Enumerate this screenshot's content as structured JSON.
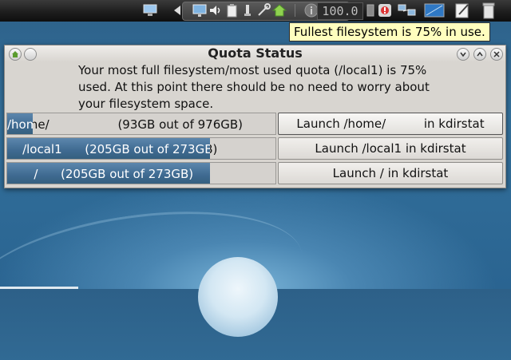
{
  "panel": {
    "network_label": "100.0",
    "icons": [
      "monitor-icon",
      "audio-icon",
      "display-icon",
      "volume-icon",
      "clipboard-icon",
      "power-icon",
      "tools-icon",
      "home-icon",
      "info-icon",
      "mail-alert-icon",
      "network-icon",
      "desktop-icon",
      "note-icon",
      "trash-icon"
    ]
  },
  "tooltip": {
    "text": "Fullest filesystem is 75% in use."
  },
  "window": {
    "title": "Quota Status",
    "message": "Your most full filesystem/most used quota (/local1) is 75% used.    At this point there should be no need to worry about your filesystem space.",
    "filesystems": [
      {
        "bar_label": "/home/                  (93GB out of 976GB)",
        "used_fraction": 0.095,
        "button_label": "Launch /home/          in kdirstat",
        "button_active": true
      },
      {
        "bar_label": "    /local1      (205GB out of 273GB)",
        "used_fraction": 0.75,
        "button_label": "Launch /local1 in kdirstat",
        "button_active": false
      },
      {
        "bar_label": "       /      (205GB out of 273GB)",
        "used_fraction": 0.75,
        "button_label": "Launch / in kdirstat",
        "button_active": false
      }
    ]
  },
  "colors": {
    "accent": "#4a749c",
    "tooltip_bg": "#fffebe",
    "panel_bg": "#1e1e1e"
  }
}
